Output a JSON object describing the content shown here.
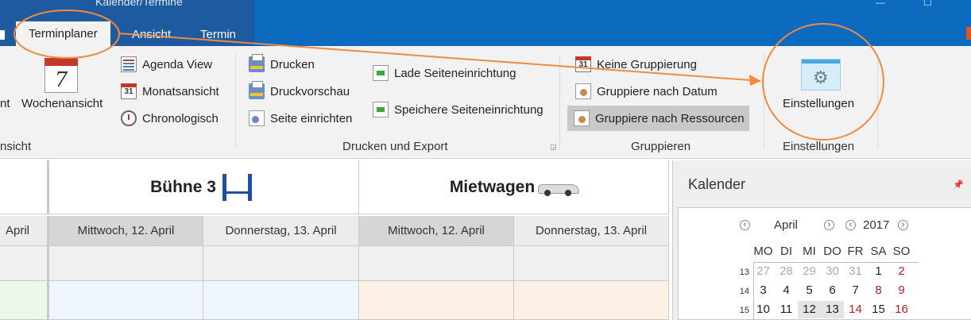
{
  "window": {
    "title": "Kalender/Termine"
  },
  "tabs": [
    {
      "label": "Terminplaner",
      "active": true
    },
    {
      "label": "Ansicht",
      "active": false
    },
    {
      "label": "Termin",
      "active": false
    }
  ],
  "ribbon": {
    "ansicht_group": {
      "label_partial": "nsicht",
      "cut_item_partial": "nt",
      "wochenansicht": "Wochenansicht",
      "wochen_day_number": "7",
      "agenda_view": "Agenda View",
      "monatsansicht": "Monatsansicht",
      "monats_icon_number": "31",
      "chronologisch": "Chronologisch"
    },
    "drucken_group": {
      "label": "Drucken und Export",
      "drucken": "Drucken",
      "druckvorschau": "Druckvorschau",
      "seite_einrichten": "Seite einrichten",
      "lade_seiteneinrichtung": "Lade Seiteneinrichtung",
      "speichere_seiteneinrichtung": "Speichere Seiteneinrichtung"
    },
    "gruppieren_group": {
      "label": "Gruppieren",
      "keine_gruppierung": "Keine Gruppierung",
      "keine_icon_number": "31",
      "gruppiere_datum": "Gruppiere nach Datum",
      "gruppiere_ressourcen": "Gruppiere nach Ressourcen"
    },
    "einstellungen_group": {
      "label": "Einstellungen",
      "button": "Einstellungen"
    }
  },
  "scheduler": {
    "cut_date_partial": "April",
    "resources": [
      {
        "name": "Bühne 3",
        "dates": [
          "Mittwoch, 12. April",
          "Donnerstag, 13. April"
        ],
        "color": "#eef5fb"
      },
      {
        "name": "Mietwagen",
        "dates": [
          "Mittwoch, 12. April",
          "Donnerstag, 13. April"
        ],
        "color": "#fdf0e4"
      }
    ],
    "cut_column_color": "#eef8ea"
  },
  "calendar": {
    "title": "Kalender",
    "month": "April",
    "year": "2017",
    "weekdays": [
      "MO",
      "DI",
      "MI",
      "DO",
      "FR",
      "SA",
      "SO"
    ],
    "weeks": [
      {
        "num": "13",
        "days": [
          "27",
          "28",
          "29",
          "30",
          "31",
          "1",
          "2"
        ]
      },
      {
        "num": "14",
        "days": [
          "3",
          "4",
          "5",
          "6",
          "7",
          "8",
          "9"
        ]
      },
      {
        "num": "15",
        "days": [
          "10",
          "11",
          "12",
          "13",
          "14",
          "15",
          "16"
        ]
      }
    ]
  },
  "colors": {
    "tabbar": "#0d6bbf",
    "annotation": "#f08a3e",
    "weekend": "#b22222"
  }
}
